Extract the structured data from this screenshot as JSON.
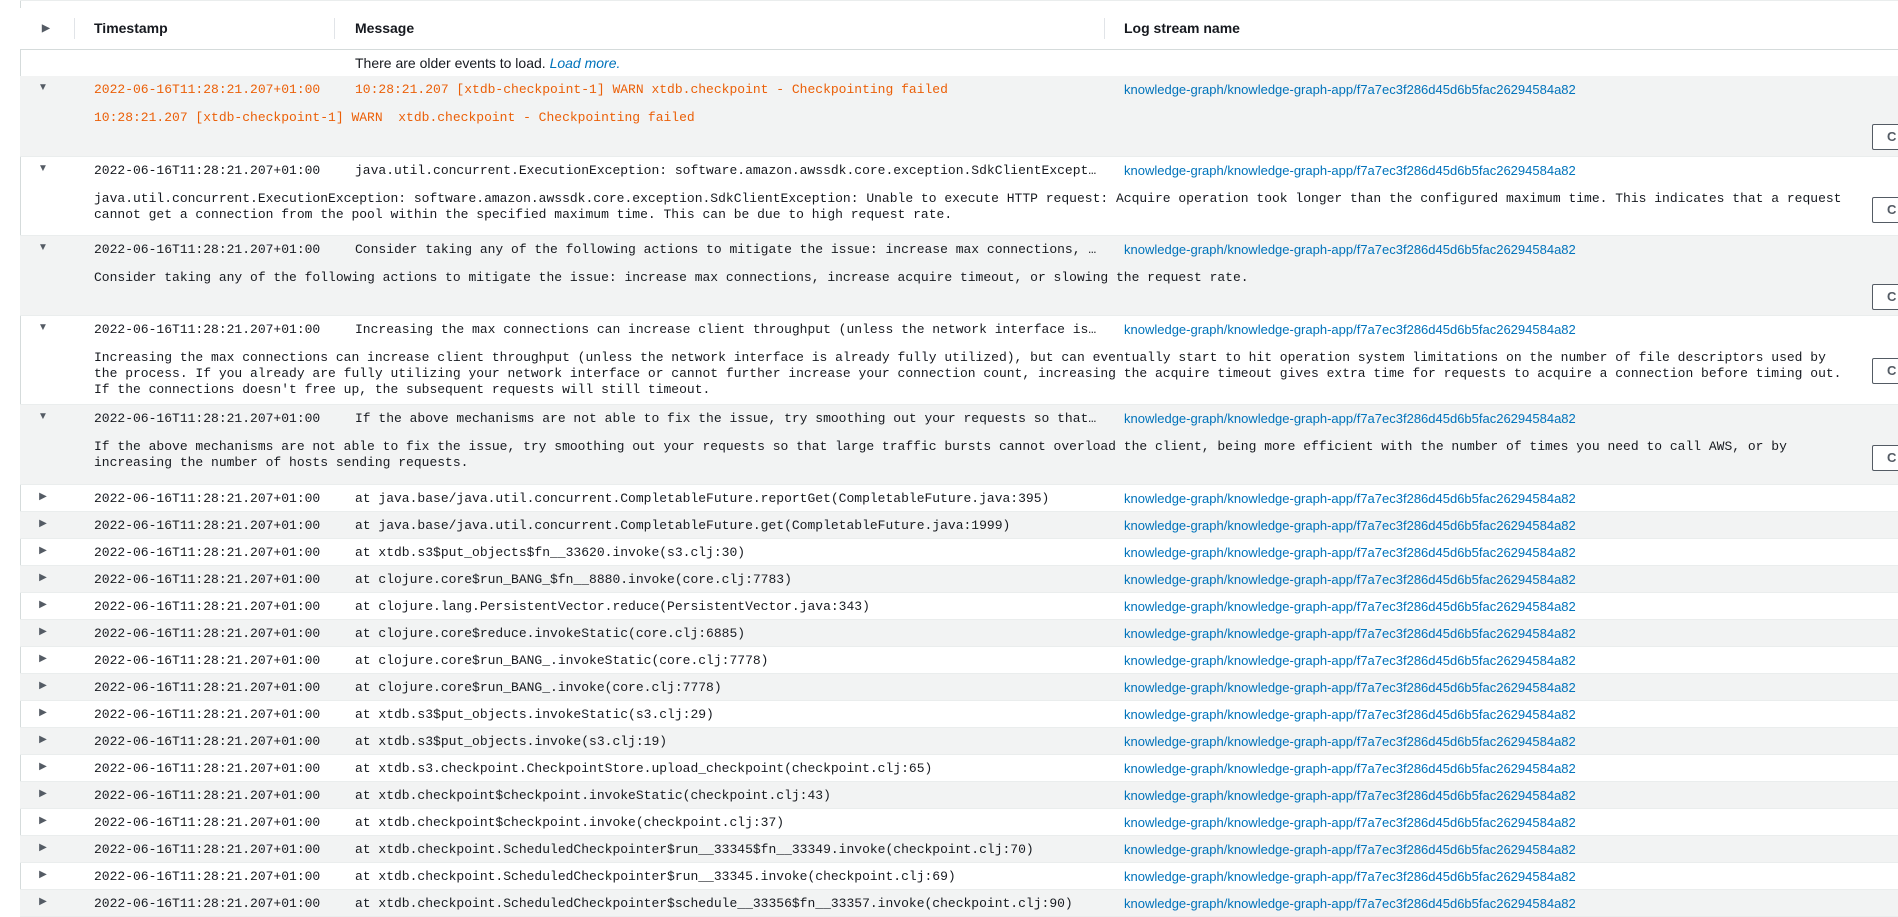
{
  "header": {
    "timestamp": "Timestamp",
    "message": "Message",
    "log_stream": "Log stream name"
  },
  "load_more": {
    "text": "There are older events to load.",
    "link": "Load more."
  },
  "copy_label": "C",
  "expanded": [
    {
      "timestamp": "2022-06-16T11:28:21.207+01:00",
      "message": "10:28:21.207 [xtdb-checkpoint-1] WARN xtdb.checkpoint - Checkpointing failed",
      "stream": "knowledge-graph/knowledge-graph-app/f7a7ec3f286d45d6b5fac26294584a82",
      "detail": "10:28:21.207 [xtdb-checkpoint-1] WARN  xtdb.checkpoint - Checkpointing failed"
    },
    {
      "timestamp": "2022-06-16T11:28:21.207+01:00",
      "message": "java.util.concurrent.ExecutionException: software.amazon.awssdk.core.exception.SdkClientException: U…",
      "stream": "knowledge-graph/knowledge-graph-app/f7a7ec3f286d45d6b5fac26294584a82",
      "detail": "java.util.concurrent.ExecutionException: software.amazon.awssdk.core.exception.SdkClientException: Unable to execute HTTP request: Acquire operation took longer than the configured maximum time. This indicates that a request cannot get a connection from the pool within the specified maximum time. This can be due to high request rate."
    },
    {
      "timestamp": "2022-06-16T11:28:21.207+01:00",
      "message": "Consider taking any of the following actions to mitigate the issue: increase max connections, increa…",
      "stream": "knowledge-graph/knowledge-graph-app/f7a7ec3f286d45d6b5fac26294584a82",
      "detail": "Consider taking any of the following actions to mitigate the issue: increase max connections, increase acquire timeout, or slowing the request rate."
    },
    {
      "timestamp": "2022-06-16T11:28:21.207+01:00",
      "message": "Increasing the max connections can increase client throughput (unless the network interface is alrea…",
      "stream": "knowledge-graph/knowledge-graph-app/f7a7ec3f286d45d6b5fac26294584a82",
      "detail": "Increasing the max connections can increase client throughput (unless the network interface is already fully utilized), but can eventually start to hit operation system limitations on the number of file descriptors used by the process. If you already are fully utilizing your network interface or cannot further increase your connection count, increasing the acquire timeout gives extra time for requests to acquire a connection before timing out. If the connections doesn't free up, the subsequent requests will still timeout."
    },
    {
      "timestamp": "2022-06-16T11:28:21.207+01:00",
      "message": "If the above mechanisms are not able to fix the issue, try smoothing out your requests so that large…",
      "stream": "knowledge-graph/knowledge-graph-app/f7a7ec3f286d45d6b5fac26294584a82",
      "detail": "If the above mechanisms are not able to fix the issue, try smoothing out your requests so that large traffic bursts cannot overload the client, being more efficient with the number of times you need to call AWS, or by increasing the number of hosts sending requests."
    }
  ],
  "collapsed": [
    {
      "timestamp": "2022-06-16T11:28:21.207+01:00",
      "message": "at java.base/java.util.concurrent.CompletableFuture.reportGet(CompletableFuture.java:395)",
      "stream": "knowledge-graph/knowledge-graph-app/f7a7ec3f286d45d6b5fac26294584a82"
    },
    {
      "timestamp": "2022-06-16T11:28:21.207+01:00",
      "message": "at java.base/java.util.concurrent.CompletableFuture.get(CompletableFuture.java:1999)",
      "stream": "knowledge-graph/knowledge-graph-app/f7a7ec3f286d45d6b5fac26294584a82"
    },
    {
      "timestamp": "2022-06-16T11:28:21.207+01:00",
      "message": "at xtdb.s3$put_objects$fn__33620.invoke(s3.clj:30)",
      "stream": "knowledge-graph/knowledge-graph-app/f7a7ec3f286d45d6b5fac26294584a82"
    },
    {
      "timestamp": "2022-06-16T11:28:21.207+01:00",
      "message": "at clojure.core$run_BANG_$fn__8880.invoke(core.clj:7783)",
      "stream": "knowledge-graph/knowledge-graph-app/f7a7ec3f286d45d6b5fac26294584a82"
    },
    {
      "timestamp": "2022-06-16T11:28:21.207+01:00",
      "message": "at clojure.lang.PersistentVector.reduce(PersistentVector.java:343)",
      "stream": "knowledge-graph/knowledge-graph-app/f7a7ec3f286d45d6b5fac26294584a82"
    },
    {
      "timestamp": "2022-06-16T11:28:21.207+01:00",
      "message": "at clojure.core$reduce.invokeStatic(core.clj:6885)",
      "stream": "knowledge-graph/knowledge-graph-app/f7a7ec3f286d45d6b5fac26294584a82"
    },
    {
      "timestamp": "2022-06-16T11:28:21.207+01:00",
      "message": "at clojure.core$run_BANG_.invokeStatic(core.clj:7778)",
      "stream": "knowledge-graph/knowledge-graph-app/f7a7ec3f286d45d6b5fac26294584a82"
    },
    {
      "timestamp": "2022-06-16T11:28:21.207+01:00",
      "message": "at clojure.core$run_BANG_.invoke(core.clj:7778)",
      "stream": "knowledge-graph/knowledge-graph-app/f7a7ec3f286d45d6b5fac26294584a82"
    },
    {
      "timestamp": "2022-06-16T11:28:21.207+01:00",
      "message": "at xtdb.s3$put_objects.invokeStatic(s3.clj:29)",
      "stream": "knowledge-graph/knowledge-graph-app/f7a7ec3f286d45d6b5fac26294584a82"
    },
    {
      "timestamp": "2022-06-16T11:28:21.207+01:00",
      "message": "at xtdb.s3$put_objects.invoke(s3.clj:19)",
      "stream": "knowledge-graph/knowledge-graph-app/f7a7ec3f286d45d6b5fac26294584a82"
    },
    {
      "timestamp": "2022-06-16T11:28:21.207+01:00",
      "message": "at xtdb.s3.checkpoint.CheckpointStore.upload_checkpoint(checkpoint.clj:65)",
      "stream": "knowledge-graph/knowledge-graph-app/f7a7ec3f286d45d6b5fac26294584a82"
    },
    {
      "timestamp": "2022-06-16T11:28:21.207+01:00",
      "message": "at xtdb.checkpoint$checkpoint.invokeStatic(checkpoint.clj:43)",
      "stream": "knowledge-graph/knowledge-graph-app/f7a7ec3f286d45d6b5fac26294584a82"
    },
    {
      "timestamp": "2022-06-16T11:28:21.207+01:00",
      "message": "at xtdb.checkpoint$checkpoint.invoke(checkpoint.clj:37)",
      "stream": "knowledge-graph/knowledge-graph-app/f7a7ec3f286d45d6b5fac26294584a82"
    },
    {
      "timestamp": "2022-06-16T11:28:21.207+01:00",
      "message": "at xtdb.checkpoint.ScheduledCheckpointer$run__33345$fn__33349.invoke(checkpoint.clj:70)",
      "stream": "knowledge-graph/knowledge-graph-app/f7a7ec3f286d45d6b5fac26294584a82"
    },
    {
      "timestamp": "2022-06-16T11:28:21.207+01:00",
      "message": "at xtdb.checkpoint.ScheduledCheckpointer$run__33345.invoke(checkpoint.clj:69)",
      "stream": "knowledge-graph/knowledge-graph-app/f7a7ec3f286d45d6b5fac26294584a82"
    },
    {
      "timestamp": "2022-06-16T11:28:21.207+01:00",
      "message": "at xtdb.checkpoint.ScheduledCheckpointer$schedule__33356$fn__33357.invoke(checkpoint.clj:90)",
      "stream": "knowledge-graph/knowledge-graph-app/f7a7ec3f286d45d6b5fac26294584a82"
    }
  ]
}
